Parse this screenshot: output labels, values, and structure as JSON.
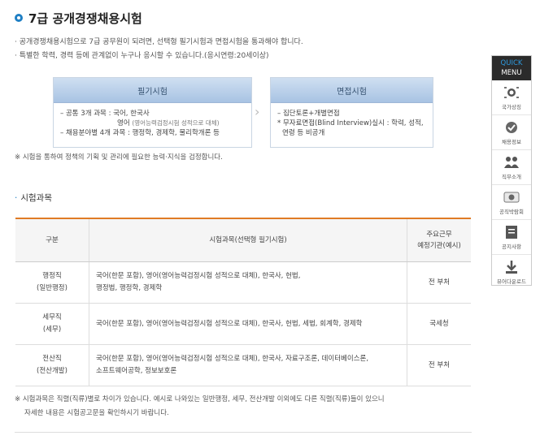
{
  "page_title": "7급 공개경쟁채용시험",
  "intro": [
    "· 공개경쟁채용시험으로 7급 공무원이 되려면, 선택형 필기시험과 면접시험을 통과해야 합니다.",
    "· 특별한 학력, 경력 등에 관계없이 누구나 응시할 수 있습니다.(응시연령:20세이상)"
  ],
  "flow": {
    "written": {
      "title": "필기시험",
      "line1": "– 공통 3개 과목 : 국어, 한국사",
      "line2": "영어",
      "line2_sub": "(영어능력검정시험 성적으로 대체)",
      "line3": "– 채용분야별 4개 과목 : 행정학, 경제학, 물리학개론 등"
    },
    "arrow": "›",
    "interview": {
      "title": "면접시험",
      "line1": "– 집단토론+개별면접",
      "line2": "* 무자료면접(Blind Interview)실시 : 학력, 성적,",
      "line3": "연령 등 비공개"
    }
  },
  "note1": "※ 시험을 통하여 정책의 기획 및 관리에 필요한 능력·지식을 검정합니다.",
  "section": {
    "bullet": "·",
    "title": "시험과목"
  },
  "table": {
    "headers": {
      "col1": "구분",
      "col2": "시험과목(선택형 필기시험)",
      "col3_l1": "주요근무",
      "col3_l2": "예정기관(예시)"
    },
    "rows": [
      {
        "type1": "행정직",
        "type2": "(일반행정)",
        "subj1": "국어(한문 포함), 영어(영어능력검정시험 성적으로 대체), 한국사, 헌법,",
        "subj2": "행정법, 행정학, 경제학",
        "agency": "전 부처"
      },
      {
        "type1": "세무직",
        "type2": "(세무)",
        "subj1": "국어(한문 포함), 영어(영어능력검정시험 성적으로 대체), 한국사, 헌법, 세법, 회계학, 경제학",
        "subj2": "",
        "agency": "국세청"
      },
      {
        "type1": "전산직",
        "type2": "(전산개발)",
        "subj1": "국어(한문 포함), 영어(영어능력검정시험 성적으로 대체), 한국사, 자료구조론, 데이터베이스론,",
        "subj2": "소프트웨어공학, 정보보호론",
        "agency": "전 부처"
      }
    ]
  },
  "note2": [
    "※ 시험과목은 직렬(직류)별로 차이가 있습니다. 예시로 나와있는 일반행정, 세무, 전산개발 이외에도 다른 직렬(직류)들이 있으니",
    "자세한 내용은 시험공고문을 확인하시기 바랍니다."
  ],
  "quick_menu": {
    "title1": "QUICK",
    "title2": "MENU",
    "items": [
      {
        "label": "국가상징",
        "icon": "national-symbol-icon"
      },
      {
        "label": "채용정보",
        "icon": "recruit-info-icon"
      },
      {
        "label": "직무소개",
        "icon": "people-icon"
      },
      {
        "label": "공직박람회",
        "icon": "fair-icon"
      },
      {
        "label": "공지사항",
        "icon": "notice-icon"
      },
      {
        "label": "뷰어다운로드",
        "icon": "download-icon"
      }
    ]
  },
  "colors": {
    "accent_blue": "#1f7fc4",
    "table_top": "#e07b25",
    "flow_header": "#b9d0ea"
  }
}
